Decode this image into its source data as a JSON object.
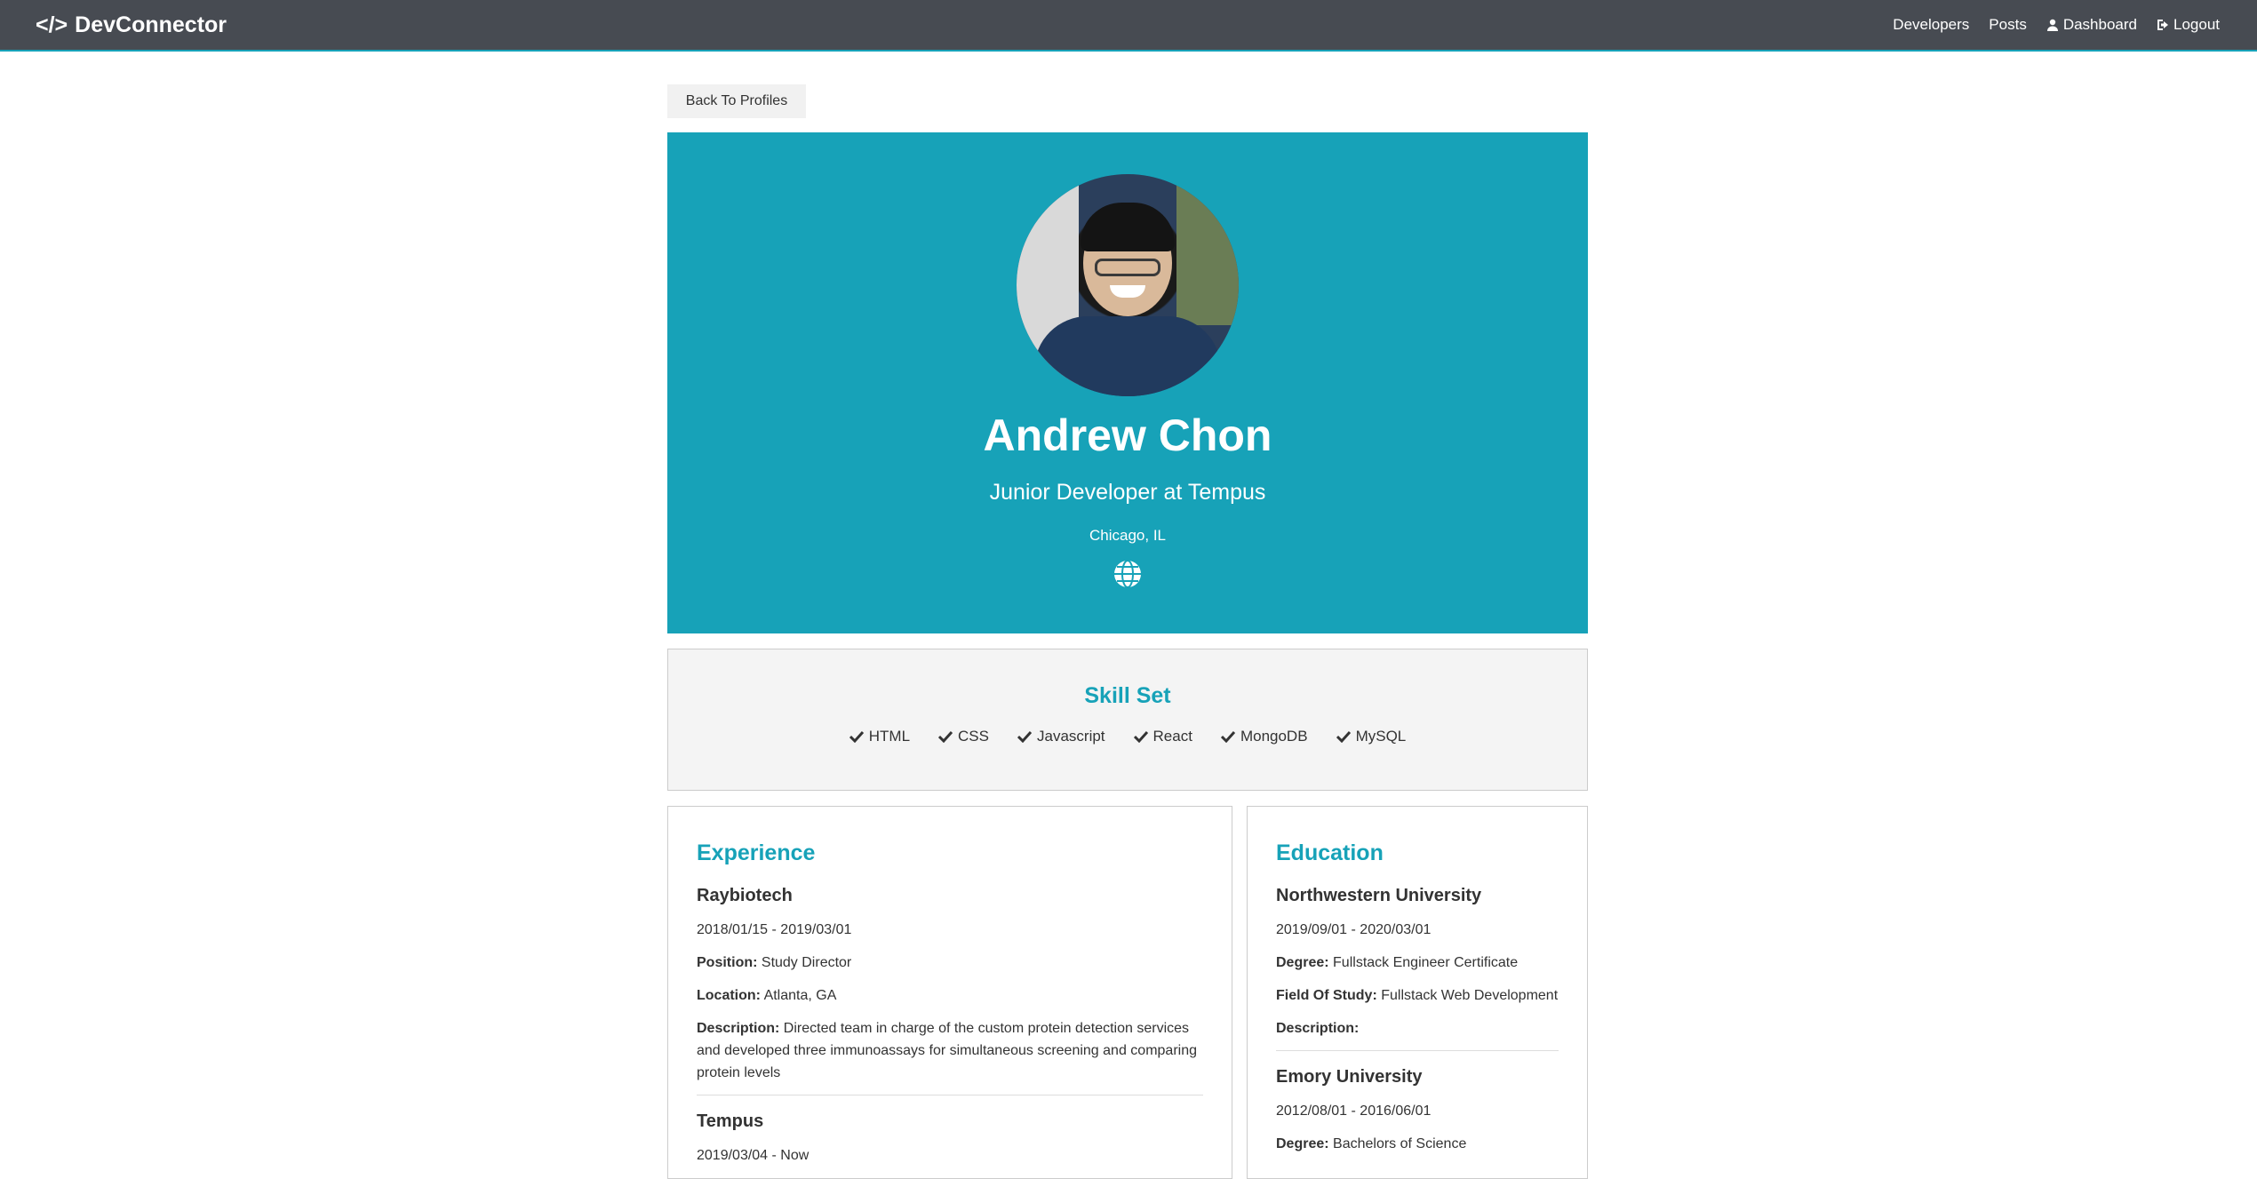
{
  "nav": {
    "brand": "DevConnector",
    "links": [
      "Developers",
      "Posts",
      "Dashboard",
      "Logout"
    ]
  },
  "back_button": "Back To Profiles",
  "profile": {
    "name": "Andrew Chon",
    "status": "Junior Developer at Tempus",
    "location": "Chicago, IL"
  },
  "skills": {
    "title": "Skill Set",
    "items": [
      "HTML",
      "CSS",
      "Javascript",
      "React",
      "MongoDB",
      "MySQL"
    ]
  },
  "experience": {
    "title": "Experience",
    "entries": [
      {
        "company": "Raybiotech",
        "dates": "2018/01/15 - 2019/03/01",
        "position_label": "Position:",
        "position": "Study Director",
        "location_label": "Location:",
        "location": "Atlanta, GA",
        "description_label": "Description:",
        "description": "Directed team in charge of the custom protein detection services and developed three immunoassays for simultaneous screening and comparing protein levels"
      },
      {
        "company": "Tempus",
        "dates": "2019/03/04 - Now"
      }
    ]
  },
  "education": {
    "title": "Education",
    "entries": [
      {
        "school": "Northwestern University",
        "dates": "2019/09/01 - 2020/03/01",
        "degree_label": "Degree:",
        "degree": "Fullstack Engineer Certificate",
        "field_label": "Field Of Study:",
        "field": "Fullstack Web Development",
        "description_label": "Description:"
      },
      {
        "school": "Emory University",
        "dates": "2012/08/01 - 2016/06/01",
        "degree_label": "Degree:",
        "degree": "Bachelors of Science"
      }
    ]
  },
  "colors": {
    "navbar": "#474b52",
    "primary": "#17a2b8",
    "light": "#f4f4f4"
  }
}
